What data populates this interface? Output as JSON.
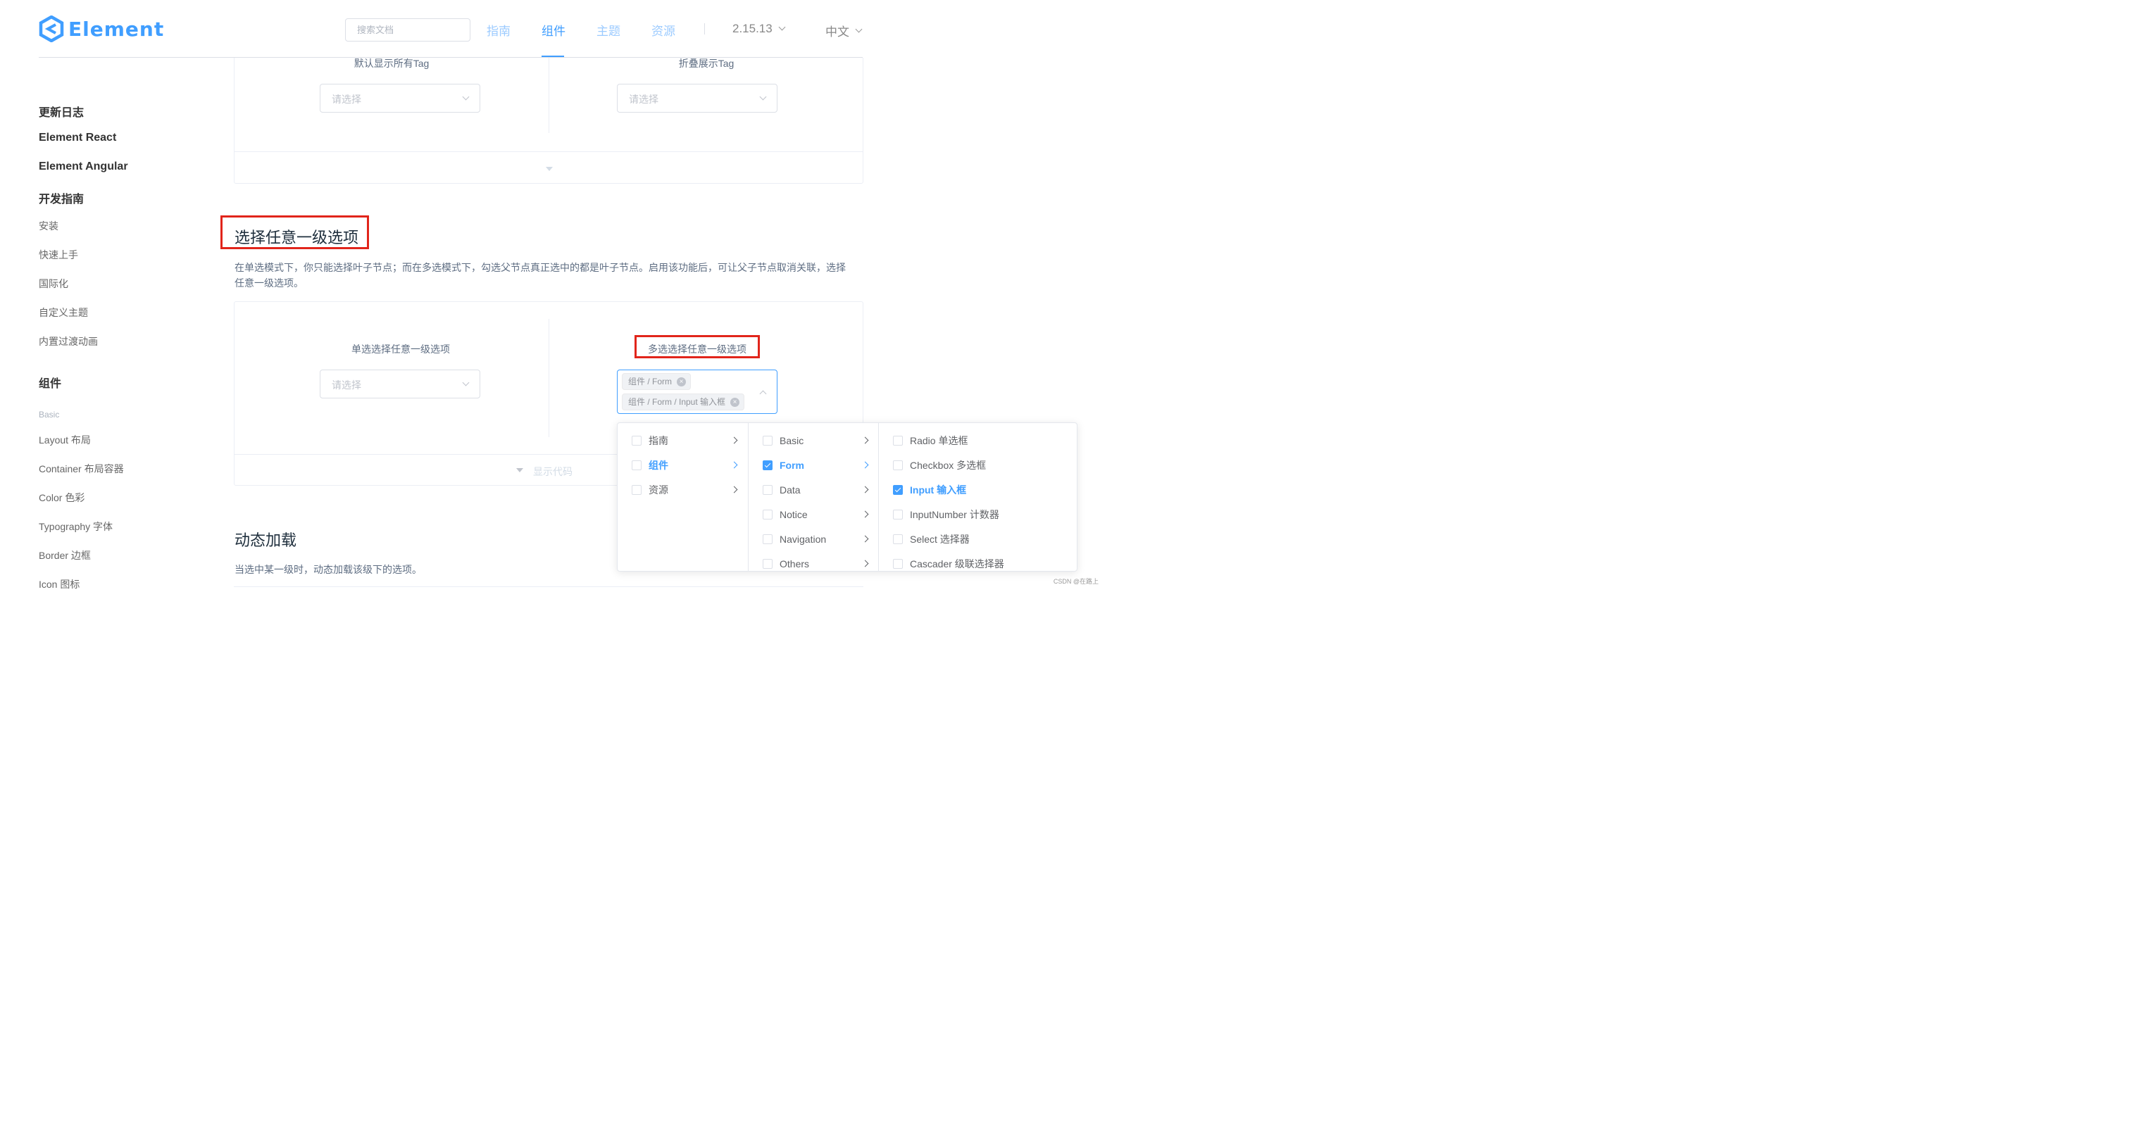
{
  "header": {
    "logo_text": "Element",
    "search_placeholder": "搜索文档",
    "nav": [
      "指南",
      "组件",
      "主题",
      "资源"
    ],
    "active_nav": "组件",
    "version": "2.15.13",
    "language": "中文"
  },
  "sidebar": {
    "headings": [
      "更新日志",
      "Element React",
      "Element Angular",
      "开发指南"
    ],
    "guide_items": [
      "安装",
      "快速上手",
      "国际化",
      "自定义主题",
      "内置过渡动画"
    ],
    "components_heading": "组件",
    "basic_label": "Basic",
    "component_items": [
      "Layout 布局",
      "Container 布局容器",
      "Color 色彩",
      "Typography 字体",
      "Border 边框",
      "Icon 图标"
    ]
  },
  "top_demo": {
    "left_label": "默认显示所有Tag",
    "right_label": "折叠展示Tag",
    "left_placeholder": "请选择",
    "right_placeholder": "请选择"
  },
  "section": {
    "title": "选择任意一级选项",
    "description_line1": "在单选模式下，你只能选择叶子节点；而在多选模式下，勾选父节点真正选中的都是叶子节点。启用该功能后，可让父子节点取消关联，选择",
    "description_line2": "任意一级选项。"
  },
  "demo": {
    "left_label": "单选选择任意一级选项",
    "right_label": "多选选择任意一级选项",
    "left_placeholder": "请选择",
    "tags": [
      "组件 / Form",
      "组件 / Form / Input 输入框"
    ],
    "show_code": "显示代码"
  },
  "cascader": {
    "col1": [
      {
        "label": "指南",
        "checked": false,
        "active": false
      },
      {
        "label": "组件",
        "checked": false,
        "active": true
      },
      {
        "label": "资源",
        "checked": false,
        "active": false
      }
    ],
    "col2": [
      {
        "label": "Basic",
        "checked": false,
        "active": false
      },
      {
        "label": "Form",
        "checked": true,
        "active": true
      },
      {
        "label": "Data",
        "checked": false,
        "active": false
      },
      {
        "label": "Notice",
        "checked": false,
        "active": false
      },
      {
        "label": "Navigation",
        "checked": false,
        "active": false
      },
      {
        "label": "Others",
        "checked": false,
        "active": false
      }
    ],
    "col3": [
      {
        "label": "Radio 单选框",
        "checked": false
      },
      {
        "label": "Checkbox 多选框",
        "checked": false
      },
      {
        "label": "Input 输入框",
        "checked": true
      },
      {
        "label": "InputNumber 计数器",
        "checked": false
      },
      {
        "label": "Select 选择器",
        "checked": false
      },
      {
        "label": "Cascader 级联选择器",
        "checked": false
      }
    ]
  },
  "next_section": {
    "title": "动态加载",
    "description": "当选中某一级时，动态加载该级下的选项。"
  },
  "watermark": "CSDN @在路上",
  "colors": {
    "primary": "#409eff",
    "highlight_border": "#e1251b"
  }
}
